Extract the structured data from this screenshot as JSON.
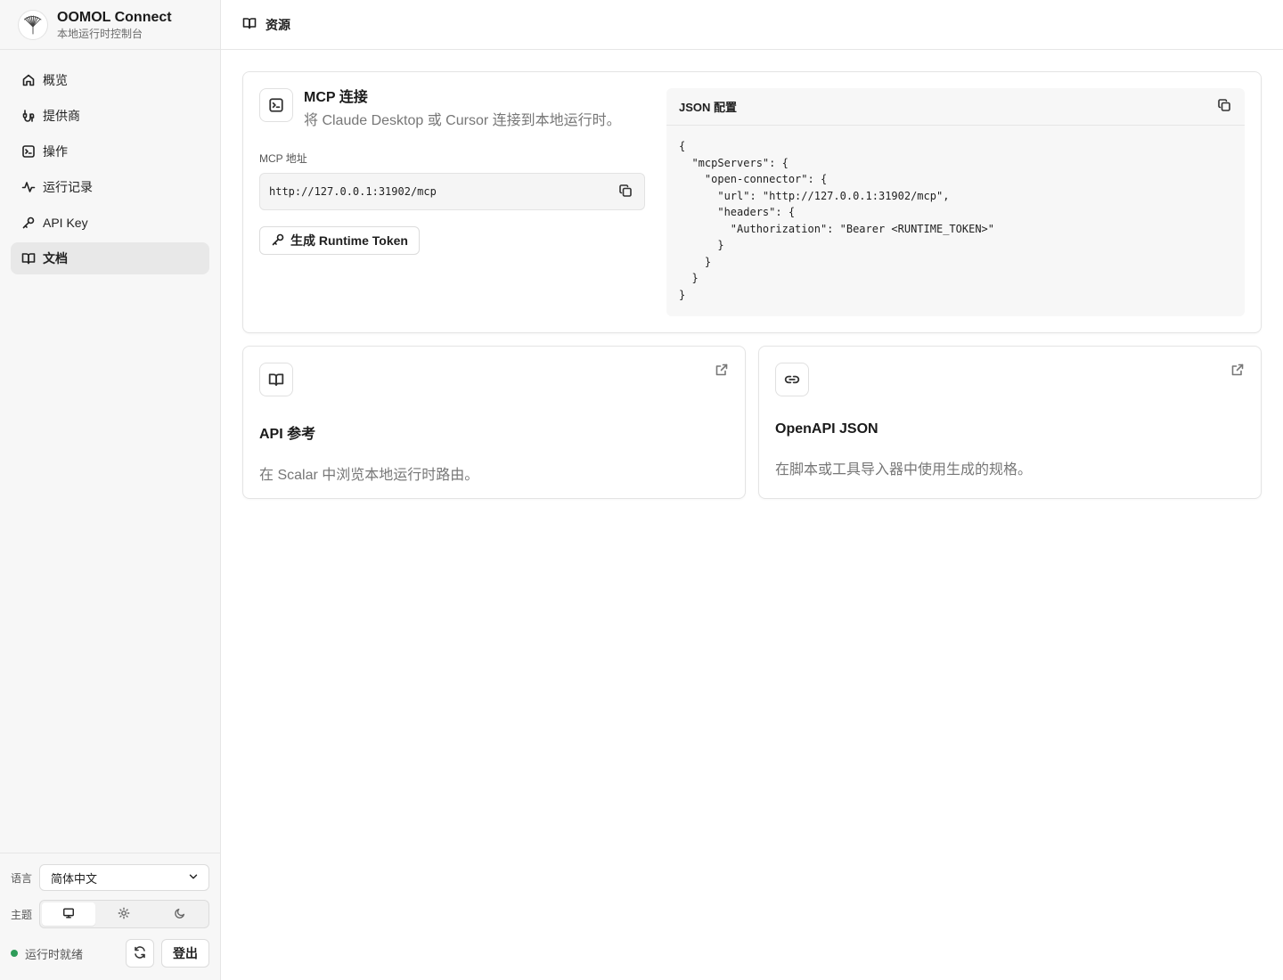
{
  "brand": {
    "title": "OOMOL Connect",
    "subtitle": "本地运行时控制台",
    "logo_icon": "ginkgo-leaf-logo"
  },
  "sidebar": {
    "items": [
      {
        "label": "概览",
        "icon": "home-icon",
        "active": false
      },
      {
        "label": "提供商",
        "icon": "plug-icon",
        "active": false
      },
      {
        "label": "操作",
        "icon": "terminal-icon",
        "active": false
      },
      {
        "label": "运行记录",
        "icon": "activity-icon",
        "active": false
      },
      {
        "label": "API Key",
        "icon": "key-icon",
        "active": false
      },
      {
        "label": "文档",
        "icon": "book-icon",
        "active": true
      }
    ],
    "language_label": "语言",
    "language_value": "简体中文",
    "theme_label": "主题",
    "theme_options": [
      "system",
      "light",
      "dark"
    ],
    "theme_selected": "system",
    "status_text": "运行时就绪",
    "status_color": "#2e9c59",
    "logout_label": "登出"
  },
  "topbar": {
    "title": "资源",
    "icon": "book-icon"
  },
  "mcp": {
    "title": "MCP 连接",
    "description": "将 Claude Desktop 或 Cursor 连接到本地运行时。",
    "address_label": "MCP 地址",
    "address_value": "http://127.0.0.1:31902/mcp",
    "generate_button": "生成 Runtime Token",
    "json_title": "JSON 配置",
    "json_code": "{\n  \"mcpServers\": {\n    \"open-connector\": {\n      \"url\": \"http://127.0.0.1:31902/mcp\",\n      \"headers\": {\n        \"Authorization\": \"Bearer <RUNTIME_TOKEN>\"\n      }\n    }\n  }\n}"
  },
  "resources": [
    {
      "title": "API 参考",
      "description": "在 Scalar 中浏览本地运行时路由。",
      "icon": "book-icon"
    },
    {
      "title": "OpenAPI JSON",
      "description": "在脚本或工具导入器中使用生成的规格。",
      "icon": "link-icon"
    }
  ]
}
